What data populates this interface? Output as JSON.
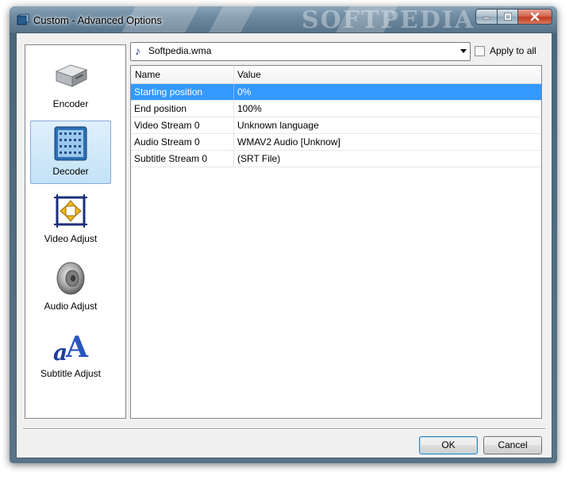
{
  "window": {
    "title": "Custom - Advanced Options",
    "watermark": "SOFTPEDIA"
  },
  "nav": {
    "items": [
      {
        "label": "Encoder",
        "icon": "drive-icon",
        "selected": false
      },
      {
        "label": "Decoder",
        "icon": "film-strip-icon",
        "selected": true
      },
      {
        "label": "Video Adjust",
        "icon": "resize-arrows-icon",
        "selected": false
      },
      {
        "label": "Audio Adjust",
        "icon": "speaker-icon",
        "selected": false
      },
      {
        "label": "Subtitle Adjust",
        "icon": "text-a-icon",
        "selected": false
      }
    ]
  },
  "file_select": {
    "value": "Softpedia.wma",
    "icon": "music-note-icon"
  },
  "apply_all": {
    "label": "Apply to all",
    "checked": false
  },
  "grid": {
    "columns": [
      "Name",
      "Value"
    ],
    "rows": [
      {
        "name": "Starting position",
        "value": "0%",
        "selected": true
      },
      {
        "name": "End position",
        "value": "100%",
        "selected": false
      },
      {
        "name": "Video Stream 0",
        "value": "Unknown language",
        "selected": false
      },
      {
        "name": "Audio Stream 0",
        "value": "WMAV2 Audio [Unknow]",
        "selected": false
      },
      {
        "name": "Subtitle Stream 0",
        "value": "(SRT File)",
        "selected": false
      }
    ]
  },
  "buttons": {
    "ok": "OK",
    "cancel": "Cancel"
  },
  "colors": {
    "selection": "#3399ff",
    "nav_selection": "#c3e2f7"
  }
}
